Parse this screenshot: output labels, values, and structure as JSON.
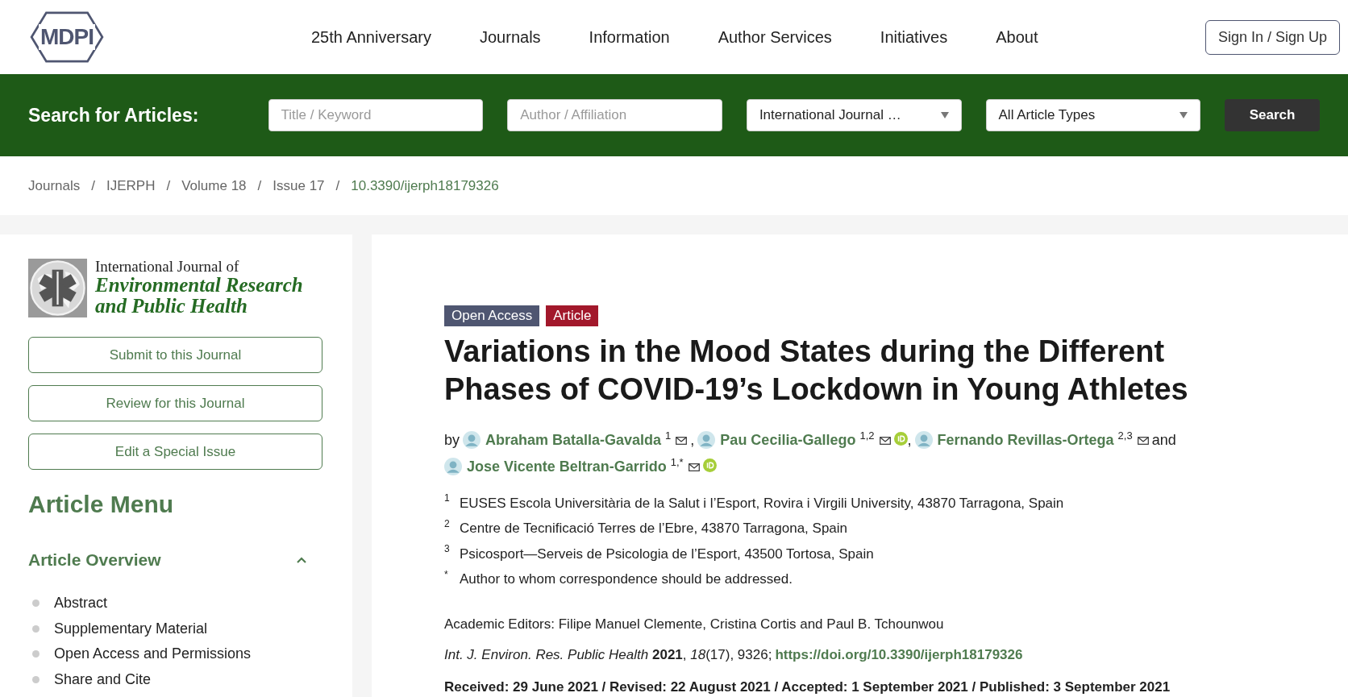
{
  "header": {
    "logo_text": "MDPI",
    "nav": [
      "25th Anniversary",
      "Journals",
      "Information",
      "Author Services",
      "Initiatives",
      "About"
    ],
    "sign_in": "Sign In / Sign Up"
  },
  "search_bar": {
    "label": "Search for Articles:",
    "fields": [
      {
        "kind": "text",
        "placeholder": "Title / Keyword"
      },
      {
        "kind": "text",
        "placeholder": "Author / Affiliation"
      },
      {
        "kind": "select",
        "value": "International Journal …"
      },
      {
        "kind": "select",
        "value": "All Article Types"
      }
    ],
    "button": "Search"
  },
  "breadcrumb": [
    {
      "label": "Journals",
      "kind": "crumb",
      "separator": "/"
    },
    {
      "label": "IJERPH",
      "kind": "crumb",
      "separator": "/"
    },
    {
      "label": "Volume 18",
      "kind": "crumb",
      "separator": "/"
    },
    {
      "label": "Issue 17",
      "kind": "crumb",
      "separator": "/"
    },
    {
      "label": "10.3390/ijerph18179326",
      "kind": "current"
    }
  ],
  "sidebar": {
    "journal": {
      "line_1": "International Journal of",
      "line_2": "Environmental Research",
      "line_3": "and Public Health"
    },
    "buttons": [
      "Submit to this Journal",
      "Review for this Journal",
      "Edit a Special Issue"
    ],
    "menu_title": "Article Menu",
    "section": {
      "title": "Article Overview",
      "expanded": true,
      "items": [
        "Abstract",
        "Supplementary Material",
        "Open Access and Permissions",
        "Share and Cite"
      ]
    }
  },
  "article": {
    "tags": [
      {
        "label": "Open Access",
        "color": "#4f5671"
      },
      {
        "label": "Article",
        "color": "#a2182b"
      }
    ],
    "title": "Variations in the Mood States during the Different Phases of COVID-19’s Lockdown in Young Athletes",
    "by": "by",
    "conjunction": "and",
    "authors": [
      {
        "name": "Abraham Batalla-Gavalda",
        "affiliations": "1",
        "orcid": false,
        "separator": ","
      },
      {
        "name": "Pau Cecilia-Gallego",
        "affiliations": "1,2",
        "orcid": true,
        "separator": ","
      },
      {
        "name": "Fernando Revillas-Ortega",
        "affiliations": "2,3",
        "orcid": false
      },
      {
        "name": "Jose Vicente Beltran-Garrido",
        "affiliations": "1,*",
        "orcid": true
      }
    ],
    "affiliations": [
      {
        "mark": "1",
        "text": "EUSES Escola Universitària de la Salut i l’Esport, Rovira i Virgili University, 43870 Tarragona, Spain"
      },
      {
        "mark": "2",
        "text": "Centre de Tecnificació Terres de l’Ebre, 43870 Tarragona, Spain"
      },
      {
        "mark": "3",
        "text": "Psicosport—Serveis de Psicologia de l’Esport, 43500 Tortosa, Spain"
      },
      {
        "mark": "*",
        "text": "Author to whom correspondence should be addressed."
      }
    ],
    "editors": "Academic Editors: Filipe Manuel Clemente, Cristina Cortis and Paul B. Tchounwou",
    "citation": "*Int. J. Environ. Res. Public Health* **2021**, *18*(17), 9326;",
    "doi_link": "https://doi.org/10.3390/ijerph18179326",
    "dates": "Received: 29 June 2021 / Revised: 22 August 2021 / Accepted: 1 September 2021 / Published: 3 September 2021"
  }
}
